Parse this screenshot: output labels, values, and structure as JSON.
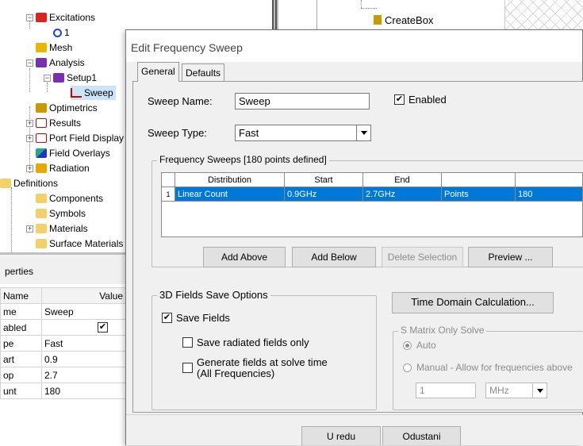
{
  "tree": {
    "items": [
      {
        "label": "Excitations"
      },
      {
        "label": "1"
      },
      {
        "label": "Mesh"
      },
      {
        "label": "Analysis"
      },
      {
        "label": "Setup1"
      },
      {
        "label": "Sweep"
      },
      {
        "label": "Optimetrics"
      },
      {
        "label": "Results"
      },
      {
        "label": "Port Field Display"
      },
      {
        "label": "Field Overlays"
      },
      {
        "label": "Radiation"
      },
      {
        "label": "Definitions"
      },
      {
        "label": "Components"
      },
      {
        "label": "Symbols"
      },
      {
        "label": "Materials"
      },
      {
        "label": "Surface Materials"
      }
    ]
  },
  "background": {
    "create_box": "CreateBox"
  },
  "properties": {
    "title": "perties",
    "col_name": "Name",
    "col_value": "Value",
    "rows": [
      {
        "name": "me",
        "value": "Sweep"
      },
      {
        "name": "abled",
        "value": ""
      },
      {
        "name": "pe",
        "value": "Fast"
      },
      {
        "name": "art",
        "value": "0.9"
      },
      {
        "name": "op",
        "value": "2.7"
      },
      {
        "name": "unt",
        "value": "180"
      }
    ]
  },
  "dialog": {
    "title": "Edit Frequency Sweep",
    "tabs": [
      "General",
      "Defaults"
    ],
    "sweep_name_label": "Sweep Name:",
    "sweep_name_value": "Sweep",
    "enabled_label": "Enabled",
    "enabled_checked": true,
    "sweep_type_label": "Sweep Type:",
    "sweep_type_value": "Fast",
    "freq_group_title": "Frequency Sweeps [180 points defined]",
    "grid": {
      "headers": [
        "Distribution",
        "Start",
        "End",
        "",
        ""
      ],
      "rows": [
        {
          "index": "1",
          "distribution": "Linear Count",
          "start": "0.9GHz",
          "end": "2.7GHz",
          "type": "Points",
          "value": "180"
        }
      ]
    },
    "buttons": {
      "add_above": "Add Above",
      "add_below": "Add Below",
      "delete_selection": "Delete Selection",
      "preview": "Preview ..."
    },
    "fields_group_title": "3D Fields Save Options",
    "save_fields_label": "Save Fields",
    "save_fields_checked": true,
    "save_radiated_label": "Save radiated fields only",
    "generate_fields_label": "Generate fields at solve time",
    "generate_fields_sub": "(All Frequencies)",
    "time_domain_label": "Time Domain Calculation...",
    "smatrix_group_title": "S Matrix Only Solve",
    "auto_label": "Auto",
    "manual_label": "Manual - Allow for frequencies above",
    "manual_value": "1",
    "manual_unit": "MHz",
    "ok_label": "U redu",
    "cancel_label": "Odustani"
  },
  "colors": {
    "selection": "#0078d7",
    "dialog_bg": "#f0f0f0"
  }
}
